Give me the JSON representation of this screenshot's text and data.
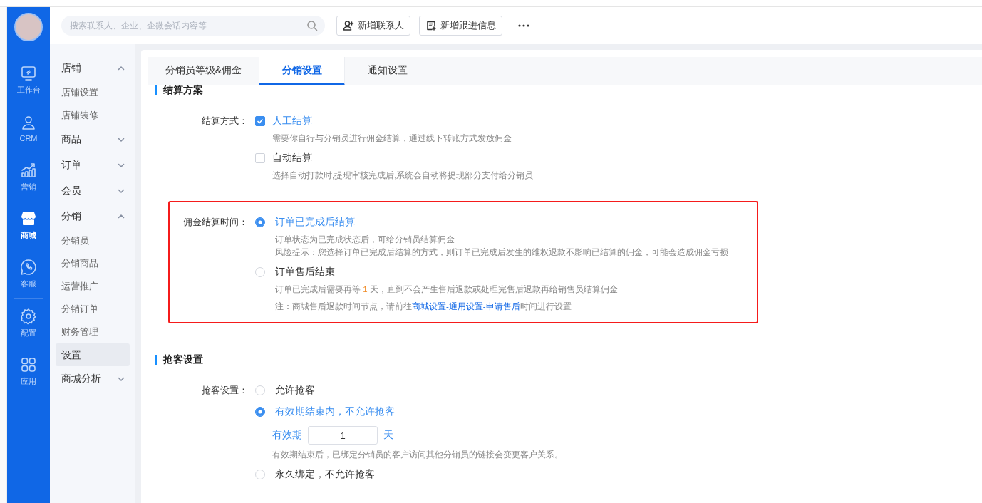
{
  "rail": {
    "groups": [
      [
        {
          "label": "工作台",
          "selected": false
        },
        {
          "label": "CRM",
          "selected": false
        },
        {
          "label": "营销",
          "selected": false
        },
        {
          "label": "商城",
          "selected": true
        },
        {
          "label": "客服",
          "selected": false
        }
      ],
      [
        {
          "label": "配置",
          "selected": false
        },
        {
          "label": "应用",
          "selected": false
        }
      ]
    ]
  },
  "topbar": {
    "search": {
      "placeholder": "搜索联系人、企业、企微会话内容等"
    },
    "buttons": [
      "新增联系人",
      "新增跟进信息"
    ]
  },
  "submenu": [
    {
      "label": "店铺",
      "expanded": true,
      "children": [
        {
          "label": "店铺设置",
          "selected": false
        },
        {
          "label": "店铺装修",
          "selected": false
        }
      ]
    },
    {
      "label": "商品",
      "expanded": false
    },
    {
      "label": "订单",
      "expanded": false
    },
    {
      "label": "会员",
      "expanded": false
    },
    {
      "label": "分销",
      "expanded": true,
      "children": [
        {
          "label": "分销员",
          "selected": false
        },
        {
          "label": "分销商品",
          "selected": false
        },
        {
          "label": "运营推广",
          "selected": false
        },
        {
          "label": "分销订单",
          "selected": false
        },
        {
          "label": "财务管理",
          "selected": false
        },
        {
          "label": "设置",
          "selected": true
        }
      ]
    },
    {
      "label": "商城分析",
      "expanded": false
    }
  ],
  "tabs": [
    {
      "label": "分销员等级&佣金",
      "selected": false
    },
    {
      "label": "分销设置",
      "selected": true
    },
    {
      "label": "通知设置",
      "selected": false
    }
  ],
  "sections": [
    {
      "title": "结算方案",
      "fields": [
        {
          "label": "结算方式：",
          "kind": "checkbox",
          "highlighted": false,
          "options": [
            {
              "label": "人工结算",
              "selected": true,
              "hints": [
                [
                  {
                    "kind": "plain",
                    "text": "需要你自行与分销员进行佣金结算，通过线下转账方式发放佣金"
                  }
                ]
              ]
            },
            {
              "label": "自动结算",
              "selected": false,
              "hints": [
                [
                  {
                    "kind": "plain",
                    "text": "选择自动打款时,提现审核完成后,系统会自动将提现部分支付给分销员"
                  }
                ]
              ]
            }
          ]
        },
        {
          "label": "佣金结算时间：",
          "kind": "radio",
          "highlighted": true,
          "options": [
            {
              "label": "订单已完成后结算",
              "selected": true,
              "hints": [
                [
                  {
                    "kind": "plain",
                    "text": "订单状态为已完成状态后，可给分销员结算佣金"
                  }
                ],
                [
                  {
                    "kind": "plain",
                    "text": "风险提示：您选择订单已完成后结算的方式，则订单已完成后发生的维权退款不影响已结算的佣金，可能会造成佣金亏损"
                  }
                ]
              ]
            },
            {
              "label": "订单售后结束",
              "selected": false,
              "hints": [
                [
                  {
                    "kind": "plain",
                    "text": "订单已完成后需要再等 "
                  },
                  {
                    "kind": "number",
                    "text": "1"
                  },
                  {
                    "kind": "plain",
                    "text": " 天，直到不会产生售后退款或处理完售后退款再给销售员结算佣金"
                  }
                ],
                [
                  {
                    "kind": "plain",
                    "text": "注：商城售后退款时间节点，请前往"
                  },
                  {
                    "kind": "link",
                    "text": "商城设置-通用设置-申请售后"
                  },
                  {
                    "kind": "plain",
                    "text": "时间进行设置"
                  }
                ]
              ]
            }
          ]
        }
      ]
    },
    {
      "title": "抢客设置",
      "fields": [
        {
          "label": "抢客设置：",
          "kind": "radio",
          "highlighted": false,
          "options": [
            {
              "label": "允许抢客",
              "selected": false
            },
            {
              "label": "有效期结束内，不允许抢客",
              "selected": true,
              "validity": {
                "label": "有效期",
                "value": "1",
                "unit": "天"
              },
              "hints": [
                [
                  {
                    "kind": "plain",
                    "text": "有效期结束后，已绑定分销员的客户访问其他分销员的链接会变更客户关系。"
                  }
                ]
              ]
            },
            {
              "label": "永久绑定，不允许抢客",
              "selected": false
            }
          ]
        }
      ]
    }
  ]
}
